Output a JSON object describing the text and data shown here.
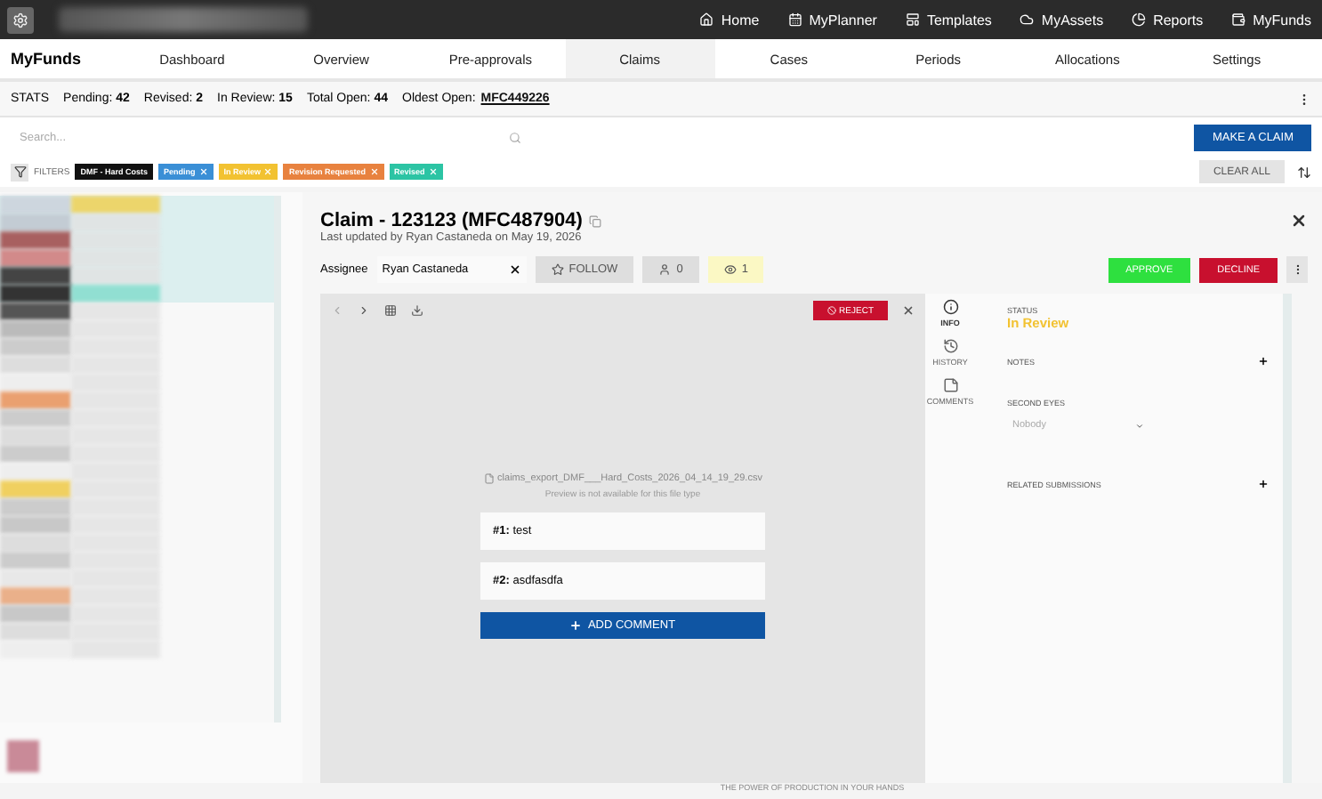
{
  "top_nav": [
    {
      "kind": "home",
      "label": "Home"
    },
    {
      "kind": "planner",
      "label": "MyPlanner"
    },
    {
      "kind": "templates",
      "label": "Templates"
    },
    {
      "kind": "assets",
      "label": "MyAssets"
    },
    {
      "kind": "reports",
      "label": "Reports"
    },
    {
      "kind": "funds",
      "label": "MyFunds"
    }
  ],
  "app_title": "MyFunds",
  "tabs": [
    {
      "label": "Dashboard",
      "selected": false
    },
    {
      "label": "Overview",
      "selected": false
    },
    {
      "label": "Pre-approvals",
      "selected": false
    },
    {
      "label": "Claims",
      "selected": true
    },
    {
      "label": "Cases",
      "selected": false
    },
    {
      "label": "Periods",
      "selected": false
    },
    {
      "label": "Allocations",
      "selected": false
    },
    {
      "label": "Settings",
      "selected": false
    }
  ],
  "stats": {
    "label": "STATS",
    "items": [
      {
        "label": "Pending:",
        "value": "42"
      },
      {
        "label": "Revised:",
        "value": "2"
      },
      {
        "label": "In Review:",
        "value": "15"
      },
      {
        "label": "Total Open:",
        "value": "44"
      }
    ],
    "oldest_label": "Oldest Open:",
    "oldest_value": "MFC449226"
  },
  "search": {
    "placeholder": "Search..."
  },
  "make_claim": "MAKE A CLAIM",
  "filters": {
    "label": "FILTERS",
    "chips": [
      {
        "label": "DMF - Hard Costs",
        "color": "#111111",
        "removable": false
      },
      {
        "label": "Pending",
        "color": "#3a8fd6",
        "removable": true
      },
      {
        "label": "In Review",
        "color": "#f2c231",
        "removable": true
      },
      {
        "label": "Revision Requested",
        "color": "#e8823f",
        "removable": true
      },
      {
        "label": "Revised",
        "color": "#2cc4a4",
        "removable": true
      }
    ],
    "clear": "CLEAR ALL"
  },
  "claim": {
    "title": "Claim - 123123 (MFC487904)",
    "updated": "Last updated by Ryan Castaneda on May 19, 2026",
    "assignee_label": "Assignee",
    "assignee": "Ryan Castaneda",
    "follow": "FOLLOW",
    "followers": "0",
    "viewers": "1",
    "approve": "APPROVE",
    "decline": "DECLINE"
  },
  "viewer": {
    "reject": "REJECT",
    "file_name": "claims_export_DMF___Hard_Costs_2026_04_14_19_29.csv",
    "preview_note": "Preview is not available for this file type",
    "comments": [
      {
        "number": "#1:",
        "text": "test"
      },
      {
        "number": "#2:",
        "text": "asdfasdfa"
      }
    ],
    "add_comment": "ADD COMMENT"
  },
  "side_tabs": [
    {
      "kind": "info",
      "label": "INFO",
      "selected": true
    },
    {
      "kind": "history",
      "label": "HISTORY",
      "selected": false
    },
    {
      "kind": "comments",
      "label": "COMMENTS",
      "selected": false
    }
  ],
  "info": {
    "status_label": "STATUS",
    "status": "In Review",
    "notes": "NOTES",
    "second_eyes": "SECOND EYES",
    "second_eyes_placeholder": "Nobody",
    "related": "RELATED SUBMISSIONS"
  },
  "footer": "THE POWER OF PRODUCTION IN YOUR HANDS"
}
